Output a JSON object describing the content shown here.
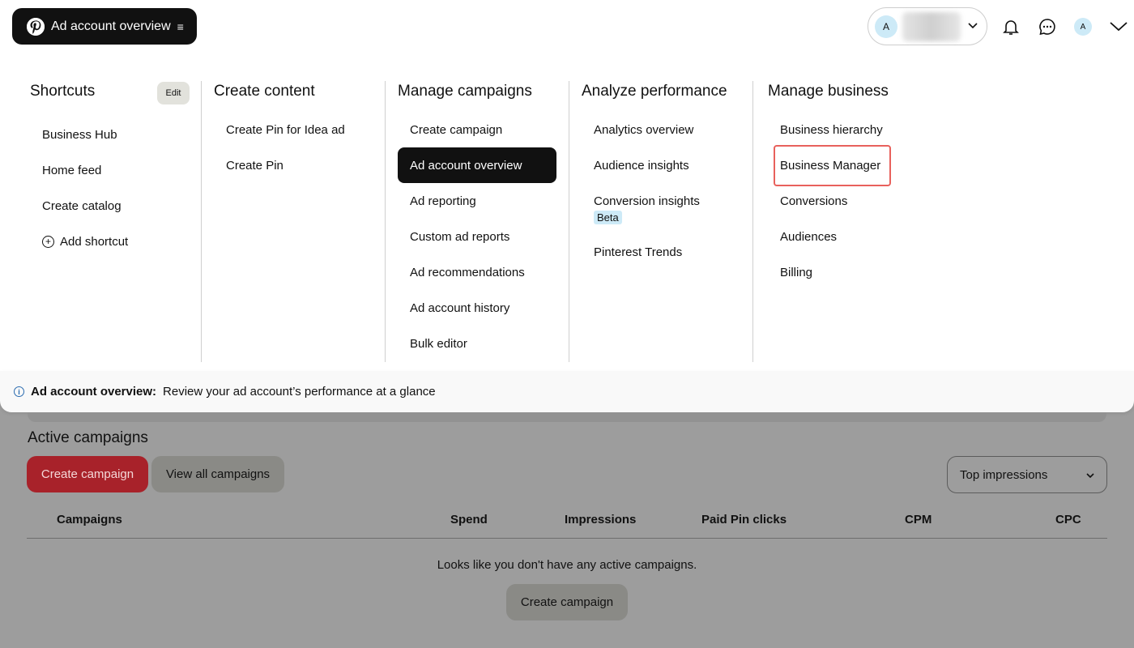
{
  "header": {
    "app_title": "Ad account overview",
    "account_avatar_letter": "A",
    "profile_avatar_letter": "A"
  },
  "menu": {
    "shortcuts": {
      "heading": "Shortcuts",
      "edit_label": "Edit",
      "items": [
        "Business Hub",
        "Home feed",
        "Create catalog"
      ],
      "add_label": "Add shortcut"
    },
    "create_content": {
      "heading": "Create content",
      "items": [
        "Create Pin for Idea ad",
        "Create Pin"
      ]
    },
    "manage_campaigns": {
      "heading": "Manage campaigns",
      "items": [
        "Create campaign",
        "Ad account overview",
        "Ad reporting",
        "Custom ad reports",
        "Ad recommendations",
        "Ad account history",
        "Bulk editor"
      ],
      "active_item": "Ad account overview"
    },
    "analyze_performance": {
      "heading": "Analyze performance",
      "items": [
        "Analytics overview",
        "Audience insights",
        "Conversion insights",
        "Pinterest Trends"
      ],
      "beta_label": "Beta"
    },
    "manage_business": {
      "heading": "Manage business",
      "items": [
        "Business hierarchy",
        "Business Manager",
        "Conversions",
        "Audiences",
        "Billing"
      ],
      "highlighted_item": "Business Manager"
    }
  },
  "infobar": {
    "label": "Ad account overview:",
    "text": "Review your ad account’s performance at a glance"
  },
  "background": {
    "section_title": "Active campaigns",
    "create_button": "Create campaign",
    "view_all_button": "View all campaigns",
    "sort_value": "Top impressions",
    "columns": [
      "Campaigns",
      "Spend",
      "Impressions",
      "Paid Pin clicks",
      "CPM",
      "CPC"
    ],
    "empty_message": "Looks like you don't have any active campaigns.",
    "empty_create_button": "Create campaign"
  },
  "colors": {
    "active_bg": "#111111",
    "highlight_outline": "#e8615c",
    "brand_red": "#a8222a",
    "beta_bg": "#cdeaf7"
  }
}
